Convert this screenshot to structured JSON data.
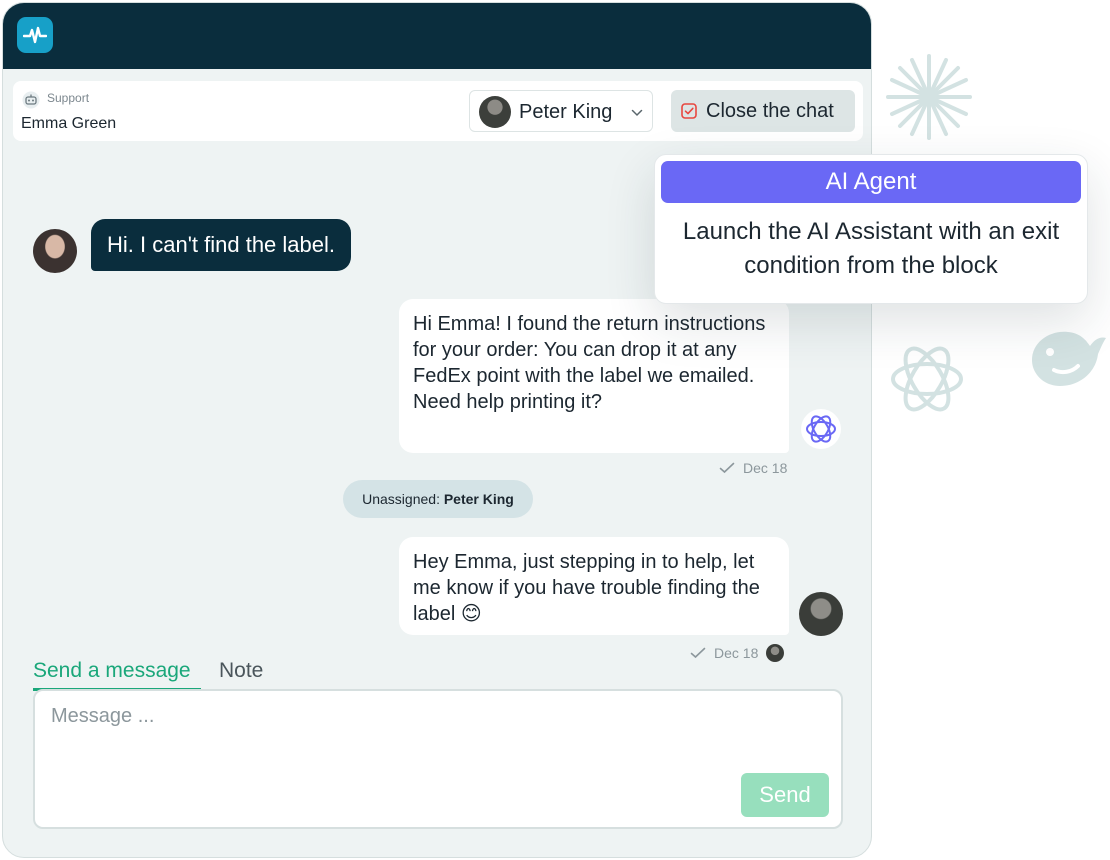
{
  "header": {
    "support_label": "Support",
    "contact_name": "Emma Green",
    "assignee": "Peter King",
    "close_label": "Close the chat"
  },
  "messages": {
    "customer_text": "Hi. I can't find the label.",
    "ai_text": "Hi Emma! I found the return instructions for your order: You can drop it at any FedEx point with the label we emailed.\nNeed help printing it?",
    "ai_date": "Dec 18",
    "system_prefix": "Unassigned: ",
    "system_name": "Peter King",
    "agent_text": "Hey Emma, just stepping in to help, let me know if you have trouble finding the label 😊",
    "agent_date": "Dec 18"
  },
  "composer": {
    "tab_send": "Send a message",
    "tab_note": "Note",
    "placeholder": "Message ...",
    "send_label": "Send"
  },
  "ai_agent_card": {
    "title": "AI Agent",
    "description": "Launch the AI Assistant with an exit condition from the block"
  },
  "colors": {
    "topbar": "#0a2d3d",
    "accent_green": "#1aa77a",
    "ai_purple": "#6a68f5",
    "logo_blue": "#17a0c8"
  }
}
